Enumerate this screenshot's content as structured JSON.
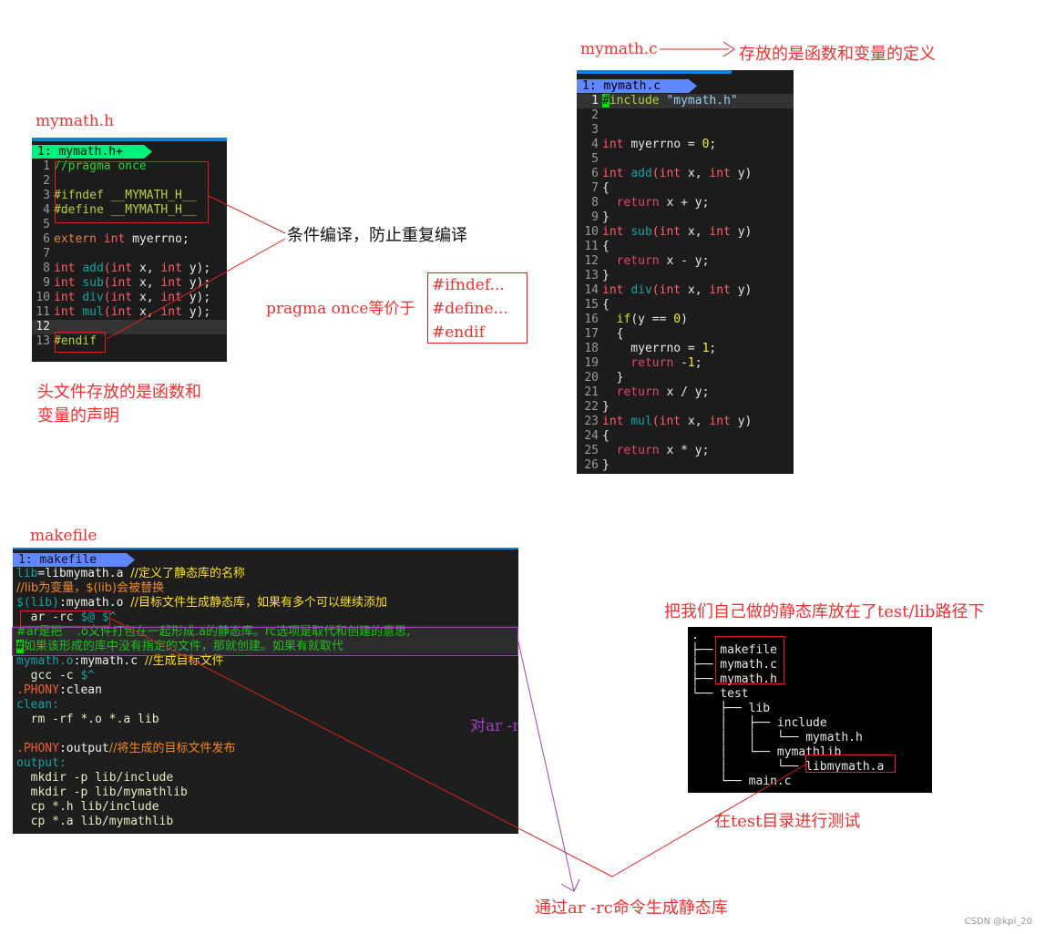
{
  "labels": {
    "mymath_h_title": "mymath.h",
    "mymath_c_title": "mymath.c",
    "mymath_c_desc": "存放的是函数和变量的定义",
    "makefile_title": "makefile",
    "header_desc_1": "头文件存放的是函数和",
    "header_desc_2": "变量的声明",
    "cond_compile": "条件编译，防止重复编译",
    "pragma_equiv": "pragma once等价于",
    "equiv_lines": [
      "#ifndef...",
      "#define...",
      "#endif"
    ],
    "ar_explain": "对ar -rc命令的解释",
    "ar_generate": "通过ar -rc命令生成静态库",
    "lib_location": "把我们自己做的静态库放在了test/lib路径下",
    "test_dir": "在test目录进行测试",
    "watermark": "CSDN @kpl_20"
  },
  "colors": {
    "annotation": "#f03030",
    "explain": "#a040c0",
    "tab_h": "#00f080",
    "tab_c": "#5f87ff"
  },
  "mymath_h": {
    "tab": "1: mymath.h+",
    "lines": [
      [
        [
          "//pragma once",
          "t-cm"
        ]
      ],
      [],
      [
        [
          "#ifndef __MYMATH_H__",
          "t-pp"
        ]
      ],
      [
        [
          "#define __MYMATH_H__",
          "t-pp"
        ]
      ],
      [],
      [
        [
          "extern ",
          "t-ext"
        ],
        [
          "int ",
          "t-kw"
        ],
        [
          "myerrno;",
          "t-pl"
        ]
      ],
      [],
      [
        [
          "int ",
          "t-kw"
        ],
        [
          "add",
          "t-fn"
        ],
        [
          "(",
          "t-kw"
        ],
        [
          "int ",
          "t-kw"
        ],
        [
          "x, ",
          "t-pl"
        ],
        [
          "int ",
          "t-kw"
        ],
        [
          "y);",
          "t-pl"
        ]
      ],
      [
        [
          "int ",
          "t-kw"
        ],
        [
          "sub",
          "t-fn"
        ],
        [
          "(",
          "t-kw"
        ],
        [
          "int ",
          "t-kw"
        ],
        [
          "x, ",
          "t-pl"
        ],
        [
          "int ",
          "t-kw"
        ],
        [
          "y);",
          "t-pl"
        ]
      ],
      [
        [
          "int ",
          "t-kw"
        ],
        [
          "div",
          "t-fn"
        ],
        [
          "(",
          "t-kw"
        ],
        [
          "int ",
          "t-kw"
        ],
        [
          "x, ",
          "t-pl"
        ],
        [
          "int ",
          "t-kw"
        ],
        [
          "y);",
          "t-pl"
        ]
      ],
      [
        [
          "int ",
          "t-kw"
        ],
        [
          "mul",
          "t-fn"
        ],
        [
          "(",
          "t-kw"
        ],
        [
          "int ",
          "t-kw"
        ],
        [
          "x, ",
          "t-pl"
        ],
        [
          "int ",
          "t-kw"
        ],
        [
          "y);",
          "t-pl"
        ]
      ],
      [],
      [
        [
          "#endif",
          "t-pp"
        ]
      ]
    ]
  },
  "mymath_c": {
    "tab": "1: mymath.c",
    "lines": [
      [
        [
          "#",
          "t-hl"
        ],
        [
          "include ",
          "t-pp"
        ],
        [
          "\"mymath.h\"",
          "t-str"
        ]
      ],
      [],
      [],
      [
        [
          "int ",
          "t-kw"
        ],
        [
          "myerrno = ",
          "t-pl"
        ],
        [
          "0",
          "t-num"
        ],
        [
          ";",
          "t-pl"
        ]
      ],
      [],
      [
        [
          "int ",
          "t-kw"
        ],
        [
          "add",
          "t-fn"
        ],
        [
          "(",
          "t-kw"
        ],
        [
          "int ",
          "t-kw"
        ],
        [
          "x, ",
          "t-pl"
        ],
        [
          "int ",
          "t-kw"
        ],
        [
          "y)",
          "t-pl"
        ]
      ],
      [
        [
          "{",
          "t-pl"
        ]
      ],
      [
        [
          "  return ",
          "t-ret"
        ],
        [
          "x + y;",
          "t-pl"
        ]
      ],
      [
        [
          "}",
          "t-pl"
        ]
      ],
      [
        [
          "int ",
          "t-kw"
        ],
        [
          "sub",
          "t-fn"
        ],
        [
          "(",
          "t-kw"
        ],
        [
          "int ",
          "t-kw"
        ],
        [
          "x, ",
          "t-pl"
        ],
        [
          "int ",
          "t-kw"
        ],
        [
          "y)",
          "t-pl"
        ]
      ],
      [
        [
          "{",
          "t-pl"
        ]
      ],
      [
        [
          "  return ",
          "t-ret"
        ],
        [
          "x - y;",
          "t-pl"
        ]
      ],
      [
        [
          "}",
          "t-pl"
        ]
      ],
      [
        [
          "int ",
          "t-kw"
        ],
        [
          "div",
          "t-fn"
        ],
        [
          "(",
          "t-kw"
        ],
        [
          "int ",
          "t-kw"
        ],
        [
          "x, ",
          "t-pl"
        ],
        [
          "int ",
          "t-kw"
        ],
        [
          "y)",
          "t-pl"
        ]
      ],
      [
        [
          "{",
          "t-pl"
        ]
      ],
      [
        [
          "  if",
          "t-if"
        ],
        [
          "(y == ",
          "t-pl"
        ],
        [
          "0",
          "t-num"
        ],
        [
          ")",
          "t-pl"
        ]
      ],
      [
        [
          "  {",
          "t-pl"
        ]
      ],
      [
        [
          "    myerrno = ",
          "t-pl"
        ],
        [
          "1",
          "t-num"
        ],
        [
          ";",
          "t-pl"
        ]
      ],
      [
        [
          "    return ",
          "t-ret"
        ],
        [
          "-",
          "t-pl"
        ],
        [
          "1",
          "t-num"
        ],
        [
          ";",
          "t-pl"
        ]
      ],
      [
        [
          "  }",
          "t-pl"
        ]
      ],
      [
        [
          "  return ",
          "t-ret"
        ],
        [
          "x / y;",
          "t-pl"
        ]
      ],
      [
        [
          "}",
          "t-pl"
        ]
      ],
      [
        [
          "int ",
          "t-kw"
        ],
        [
          "mul",
          "t-fn"
        ],
        [
          "(",
          "t-kw"
        ],
        [
          "int ",
          "t-kw"
        ],
        [
          "x, ",
          "t-pl"
        ],
        [
          "int ",
          "t-kw"
        ],
        [
          "y)",
          "t-pl"
        ]
      ],
      [
        [
          "{",
          "t-pl"
        ]
      ],
      [
        [
          "  return ",
          "t-ret"
        ],
        [
          "x * y;",
          "t-pl"
        ]
      ],
      [
        [
          "}",
          "t-pl"
        ]
      ]
    ]
  },
  "makefile": {
    "tab": "1: makefile",
    "lines": [
      [
        [
          "lib",
          "m-var"
        ],
        [
          "=libmymath.a ",
          "m-pl"
        ],
        [
          "//定义了静态库的名称",
          "m-cy"
        ]
      ],
      [
        [
          "//lib为变量，$(lib)会被替换",
          "m-co"
        ]
      ],
      [
        [
          "$(lib)",
          "m-var"
        ],
        [
          ":mymath.o ",
          "m-pl"
        ],
        [
          "//目标文件生成静态库，如果有多个可以继续添加",
          "m-cy"
        ]
      ],
      [
        [
          "  ar -rc ",
          "m-cmd"
        ],
        [
          "$@ $^",
          "m-var"
        ]
      ],
      [
        [
          "#ar是把    .o文件打包在一起形成.a的静态库。rc选项是取代和创建的意思,",
          "m-gr"
        ]
      ],
      [
        [
          "#",
          "t-hl"
        ],
        [
          "如果该形成的库中没有指定的文件，那就创建。如果有就取代",
          "m-gr"
        ]
      ],
      [
        [
          "mymath.o",
          "m-var"
        ],
        [
          ":mymath.c ",
          "m-pl"
        ],
        [
          "//生成目标文件",
          "m-cy"
        ]
      ],
      [
        [
          "  gcc -c ",
          "m-cmd"
        ],
        [
          "$^",
          "m-var"
        ]
      ],
      [
        [
          ".PHONY",
          "m-ph"
        ],
        [
          ":clean",
          "m-pl"
        ]
      ],
      [
        [
          "clean:",
          "m-var"
        ]
      ],
      [
        [
          "  rm -rf *.o *.a lib",
          "m-cmd"
        ]
      ],
      [],
      [
        [
          ".PHONY",
          "m-ph"
        ],
        [
          ":output",
          "m-pl"
        ],
        [
          "//将生成的目标文件发布",
          "m-co"
        ]
      ],
      [
        [
          "output:",
          "m-var"
        ]
      ],
      [
        [
          "  mkdir -p lib/include",
          "m-cmd"
        ]
      ],
      [
        [
          "  mkdir -p lib/mymathlib",
          "m-cmd"
        ]
      ],
      [
        [
          "  cp *.h lib/include",
          "m-cmd"
        ]
      ],
      [
        [
          "  cp *.a lib/mymathlib",
          "m-cmd"
        ]
      ]
    ]
  },
  "tree": {
    "lines": [
      ".",
      "├── makefile",
      "├── mymath.c",
      "├── mymath.h",
      "└── test",
      "    ├── lib",
      "    │   ├── include",
      "    │   │   └── mymath.h",
      "    │   └── mymathlib",
      "    │       └── libmymath.a",
      "    └── main.c"
    ]
  }
}
